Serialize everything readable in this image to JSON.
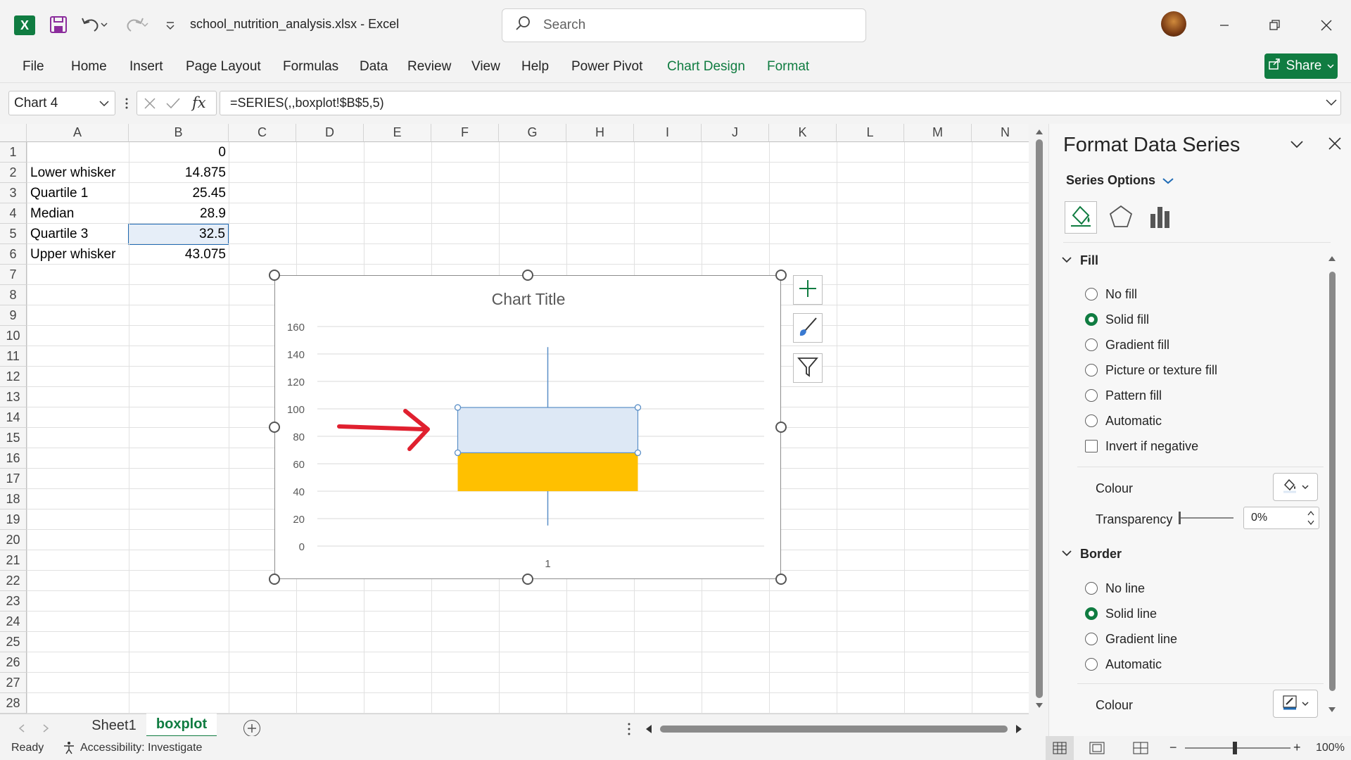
{
  "app": {
    "doc_title": "school_nutrition_analysis.xlsx  -  Excel",
    "search_placeholder": "Search",
    "logo_letter": "X"
  },
  "ribbon": {
    "tabs": [
      "File",
      "Home",
      "Insert",
      "Page Layout",
      "Formulas",
      "Data",
      "Review",
      "View",
      "Help",
      "Power Pivot",
      "Chart Design",
      "Format"
    ],
    "share_label": "Share"
  },
  "formula_bar": {
    "name_box": "Chart 4",
    "fx_label": "fx",
    "formula": "=SERIES(,,boxplot!$B$5,5)"
  },
  "grid": {
    "columns": [
      "A",
      "B",
      "C",
      "D",
      "E",
      "F",
      "G",
      "H",
      "I",
      "J",
      "K",
      "L",
      "M",
      "N"
    ],
    "rows": [
      "1",
      "2",
      "3",
      "4",
      "5",
      "6",
      "7",
      "8",
      "9",
      "10",
      "11",
      "12",
      "13",
      "14",
      "15",
      "16",
      "17",
      "18",
      "19",
      "20",
      "21",
      "22",
      "23",
      "24",
      "25",
      "26",
      "27",
      "28"
    ],
    "cells": {
      "B1": "0",
      "A2": "Lower whisker",
      "B2": "14.875",
      "A3": "Quartile 1",
      "B3": "25.45",
      "A4": "Median",
      "B4": "28.9",
      "A5": "Quartile 3",
      "B5": "32.5",
      "A6": "Upper whisker",
      "B6": "43.075"
    }
  },
  "chart_data": {
    "type": "bar",
    "title": "Chart Title",
    "categories": [
      "1"
    ],
    "ylim": [
      0,
      160
    ],
    "yticks": [
      0,
      20,
      40,
      60,
      80,
      100,
      120,
      140,
      160
    ],
    "grid": true,
    "segments": [
      {
        "bottom": 40,
        "top": 68,
        "color": "#ffc000"
      },
      {
        "bottom": 68,
        "top": 101,
        "color": "#dde8f5",
        "selected": true
      }
    ],
    "whisker": {
      "low": 15,
      "high": 145,
      "color": "#5b8fc7"
    }
  },
  "sheets": {
    "tabs": [
      "Sheet1",
      "boxplot"
    ],
    "active": "boxplot"
  },
  "status": {
    "ready": "Ready",
    "accessibility": "Accessibility: Investigate",
    "zoom": "100%"
  },
  "pane": {
    "title": "Format Data Series",
    "series_options": "Series Options",
    "fill_section": "Fill",
    "fill_options": [
      "No fill",
      "Solid fill",
      "Gradient fill",
      "Picture or texture fill",
      "Pattern fill",
      "Automatic"
    ],
    "fill_selected": 1,
    "invert_label": "Invert if negative",
    "colour_label": "Colour",
    "transparency_label": "Transparency",
    "transparency_value": "0%",
    "border_section": "Border",
    "border_options": [
      "No line",
      "Solid line",
      "Gradient line",
      "Automatic"
    ],
    "border_selected": 1,
    "border_colour_label": "Colour"
  },
  "colors": {
    "excel_green": "#107c41",
    "annotation_red": "#e0202f",
    "q1_fill": "#ffc000",
    "q3_fill": "#dde8f5"
  }
}
